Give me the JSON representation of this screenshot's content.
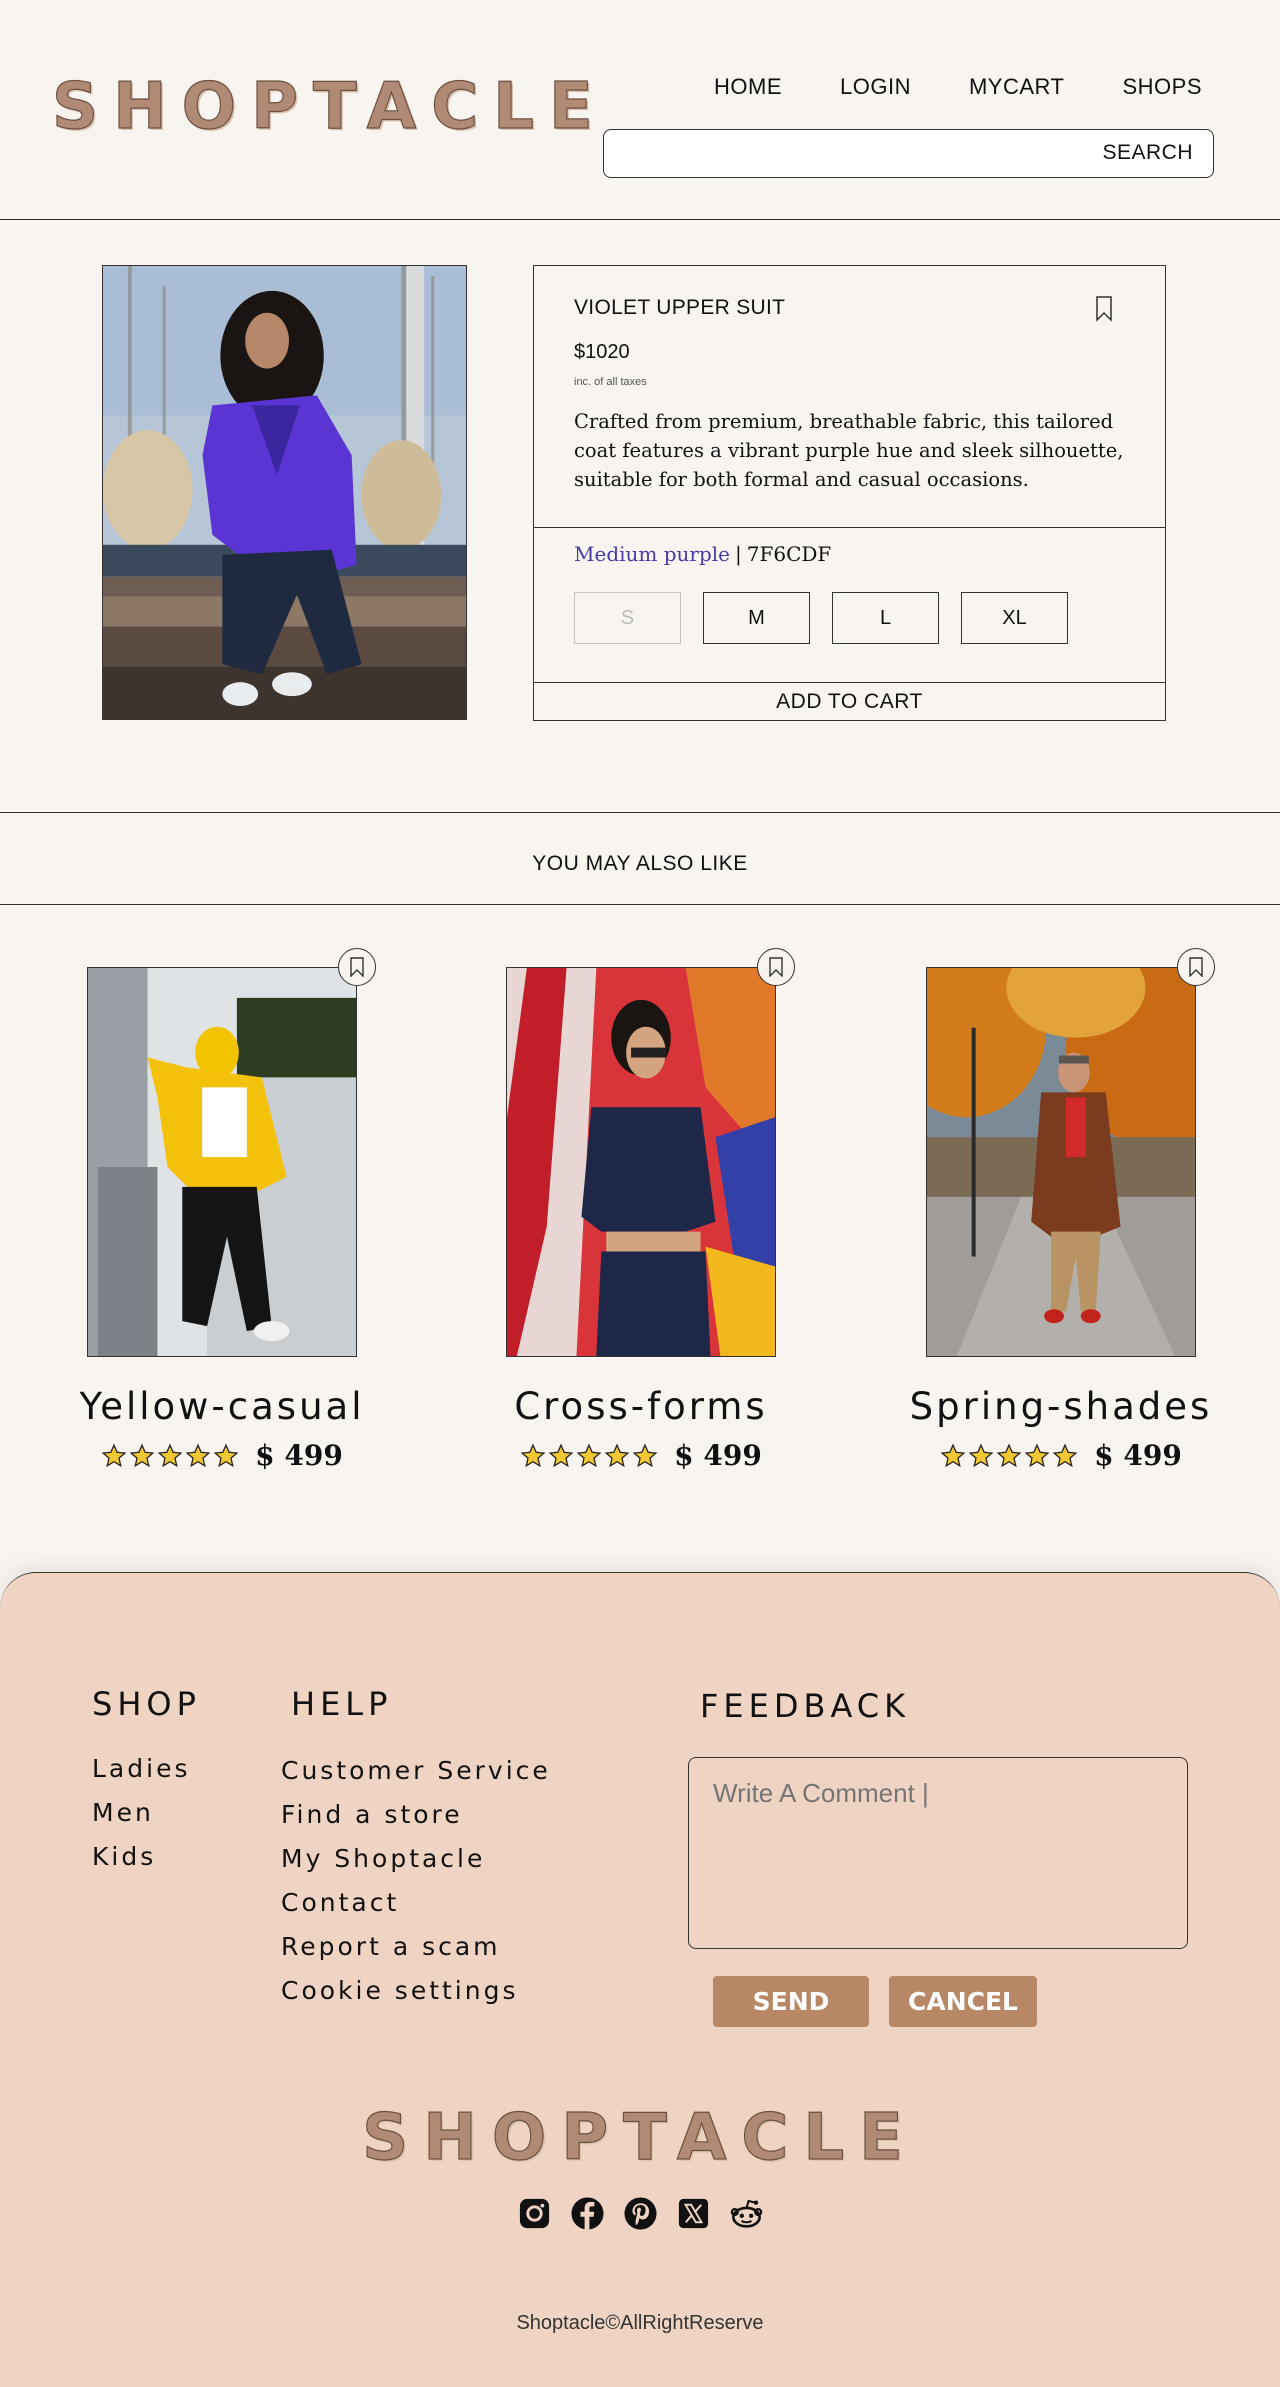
{
  "header": {
    "logo": "SHOPTACLE",
    "nav": [
      "HOME",
      "LOGIN",
      "MYCART",
      "SHOPS"
    ],
    "search_placeholder": "",
    "search_button": "SEARCH"
  },
  "product": {
    "title": "VIOLET UPPER SUIT",
    "price": "$1020",
    "tax_note": "inc. of all taxes",
    "description": "Crafted from premium, breathable fabric, this tailored coat features a vibrant purple hue and sleek silhouette, suitable for both formal and casual occasions.",
    "color_name": "Medium purple",
    "color_separator": "|",
    "color_code": "7F6CDF",
    "sizes": [
      "S",
      "M",
      "L",
      "XL"
    ],
    "add_to_cart": "ADD TO CART",
    "accent_color": "#4b39a8"
  },
  "also_like": {
    "heading": "YOU MAY ALSO LIKE",
    "items": [
      {
        "name": "Yellow-casual",
        "price": "$ 499",
        "rating": 5
      },
      {
        "name": "Cross-forms",
        "price": "$ 499",
        "rating": 5
      },
      {
        "name": "Spring-shades",
        "price": "$ 499",
        "rating": 5
      }
    ]
  },
  "footer": {
    "shop_heading": "SHOP",
    "shop_links": [
      "Ladies",
      "Men",
      "Kids"
    ],
    "help_heading": "HELP",
    "help_links": [
      "Customer Service",
      "Find a store",
      "My Shoptacle",
      "Contact",
      "Report a scam",
      "Cookie settings"
    ],
    "feedback_heading": "FEEDBACK",
    "feedback_placeholder": "Write A Comment |",
    "send": "SEND",
    "cancel": "CANCEL",
    "logo": "SHOPTACLE",
    "socials": [
      "instagram-icon",
      "facebook-icon",
      "pinterest-icon",
      "x-icon",
      "reddit-icon"
    ],
    "copyright": "Shoptacle©AllRightReserve",
    "background": "#efd4c3",
    "button_color": "#b88866"
  }
}
